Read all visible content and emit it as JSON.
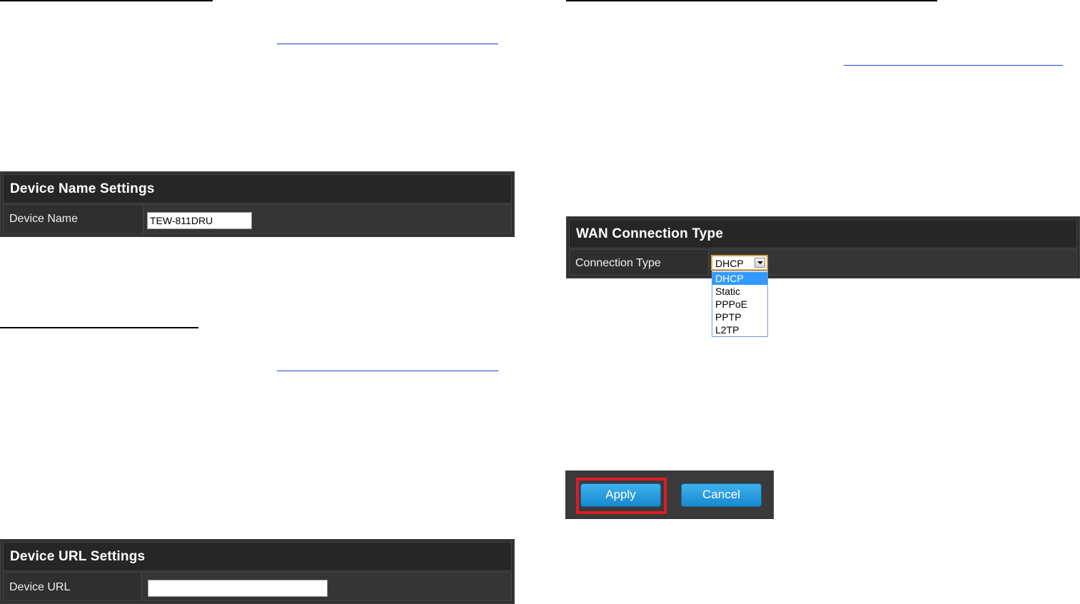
{
  "device_name_panel": {
    "title": "Device Name Settings",
    "field_label": "Device Name",
    "field_value": "TEW-811DRU"
  },
  "device_url_panel": {
    "title": "Device URL Settings",
    "field_label": "Device URL",
    "field_value": ""
  },
  "wan_panel": {
    "title": "WAN Connection Type",
    "field_label": "Connection Type",
    "selected_value": "DHCP",
    "options": [
      "DHCP",
      "Static",
      "PPPoE",
      "PPTP",
      "L2TP"
    ]
  },
  "buttons": {
    "apply_label": "Apply",
    "cancel_label": "Cancel"
  },
  "colors": {
    "panel_background": "#2c2c2c",
    "button_blue": "#1e94dc",
    "highlight_red": "#e01b24",
    "dropdown_selected": "#3399ff",
    "link_underline": "#1f3fd6"
  }
}
